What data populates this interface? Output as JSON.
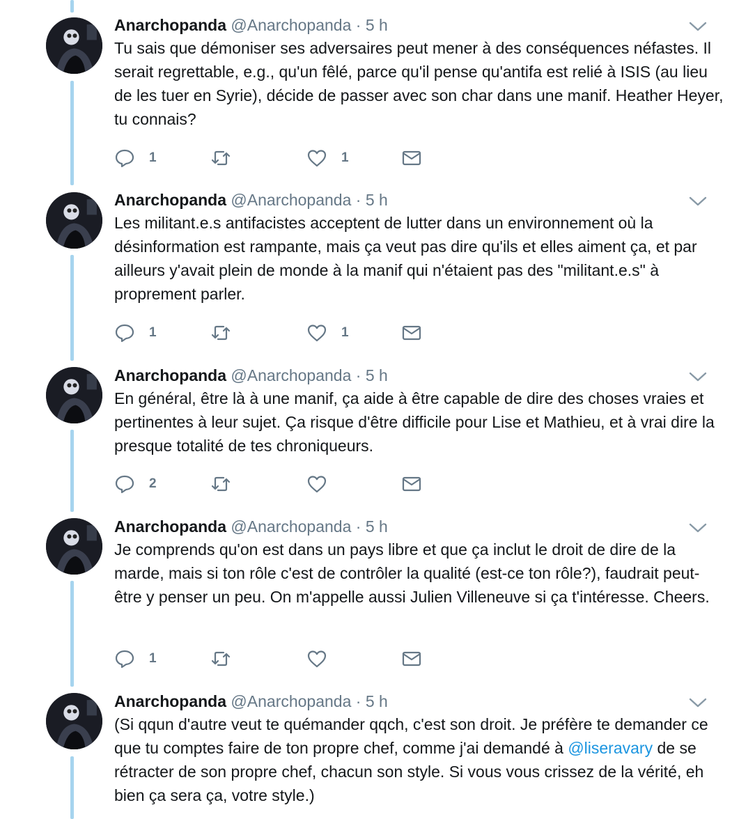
{
  "colors": {
    "thread_line": "#a6d4ee",
    "text": "#14171a",
    "secondary": "#657786",
    "mention": "#1b95e0"
  },
  "tweets": [
    {
      "name": "Anarchopanda",
      "handle": "@Anarchopanda",
      "dot": "·",
      "time": "5 h",
      "text": "Tu sais que démoniser ses adversaires peut mener à des conséquences néfastes. Il serait regrettable, e.g., qu'un fêlé, parce qu'il pense qu'antifa est relié à ISIS (au lieu de les tuer en Syrie), décide de passer avec son char dans une manif. Heather Heyer, tu connais?",
      "replies": "1",
      "retweets": "",
      "likes": "1"
    },
    {
      "name": "Anarchopanda",
      "handle": "@Anarchopanda",
      "dot": "·",
      "time": "5 h",
      "text": "Les militant.e.s antifacistes acceptent de lutter dans un environnement où la désinformation est rampante, mais ça veut pas dire qu'ils et elles aiment ça, et par ailleurs y'avait plein de monde à la manif qui n'étaient pas des \"militant.e.s\" à proprement parler.",
      "replies": "1",
      "retweets": "",
      "likes": "1"
    },
    {
      "name": "Anarchopanda",
      "handle": "@Anarchopanda",
      "dot": "·",
      "time": "5 h",
      "text": "En général, être là à une manif, ça aide à être capable de dire des choses vraies et pertinentes à leur sujet. Ça risque d'être difficile pour Lise et Mathieu, et à vrai dire la presque totalité de tes chroniqueurs.",
      "replies": "2",
      "retweets": "",
      "likes": ""
    },
    {
      "name": "Anarchopanda",
      "handle": "@Anarchopanda",
      "dot": "·",
      "time": "5 h",
      "text": "Je comprends qu'on est dans un pays libre et que ça inclut le droit de dire de la marde, mais si ton rôle c'est de contrôler la qualité (est-ce ton rôle?), faudrait peut-être y penser un peu. On m'appelle aussi Julien Villeneuve si ça t'intéresse. Cheers.",
      "replies": "1",
      "retweets": "",
      "likes": ""
    },
    {
      "name": "Anarchopanda",
      "handle": "@Anarchopanda",
      "dot": "·",
      "time": "5 h",
      "text_before": "(Si qqun d'autre veut te quémander qqch, c'est son droit. Je préfère te demander ce que tu comptes faire de ton propre chef, comme j'ai demandé à ",
      "mention": "@liseravary",
      "text_after": " de se rétracter de son propre chef, chacun son style. Si vous vous crissez de la vérité, eh bien ça sera ça, votre style.)"
    }
  ]
}
